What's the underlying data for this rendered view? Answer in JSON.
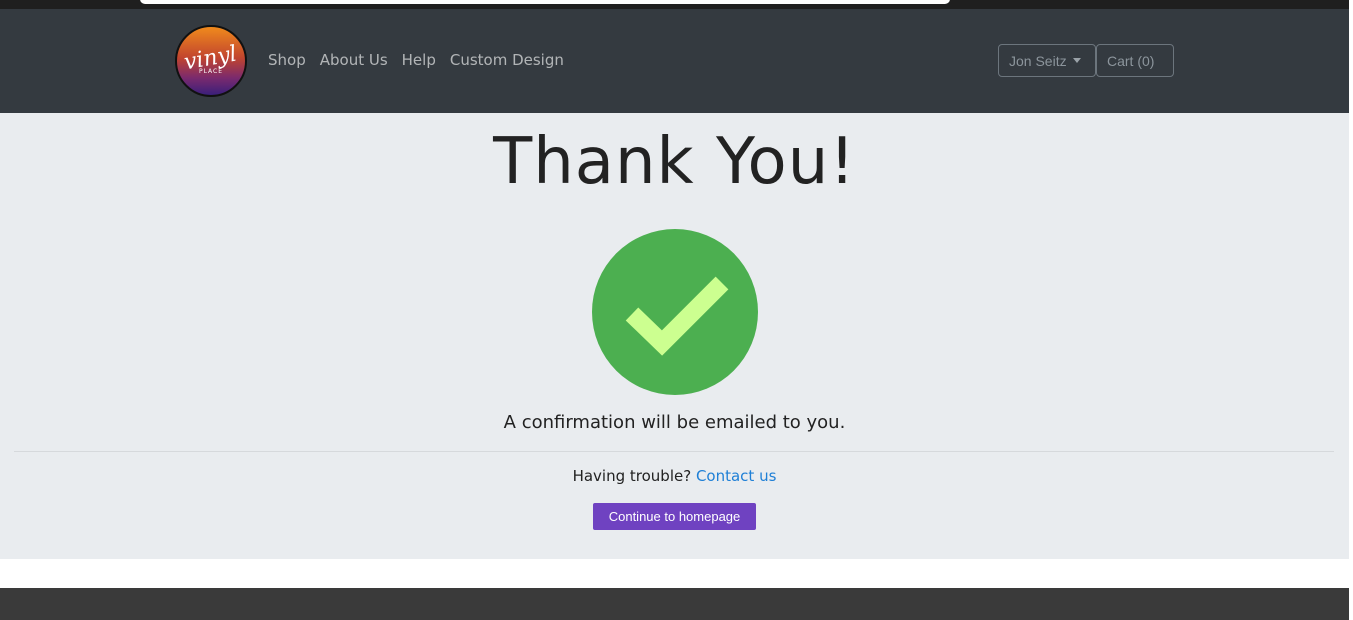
{
  "brand": {
    "logo_text": "vinyl",
    "logo_subtext": "PLACE"
  },
  "nav": {
    "links": [
      "Shop",
      "About Us",
      "Help",
      "Custom Design"
    ],
    "user_label": "Jon Seitz",
    "cart_label": "Cart (0)"
  },
  "main": {
    "title": "Thank You!",
    "confirmation": "A confirmation will be emailed to you.",
    "trouble_text": "Having trouble?",
    "contact_link": "Contact us",
    "cta_label": "Continue to homepage"
  },
  "colors": {
    "navbar": "#343a40",
    "main_bg": "#e9ecef",
    "check_circle": "#4caf50",
    "check_mark": "#ccff90",
    "cta": "#6f42c1",
    "link": "#1e7fd6"
  },
  "icons": {
    "success": "checkmark-icon",
    "dropdown": "caret-down-icon"
  }
}
